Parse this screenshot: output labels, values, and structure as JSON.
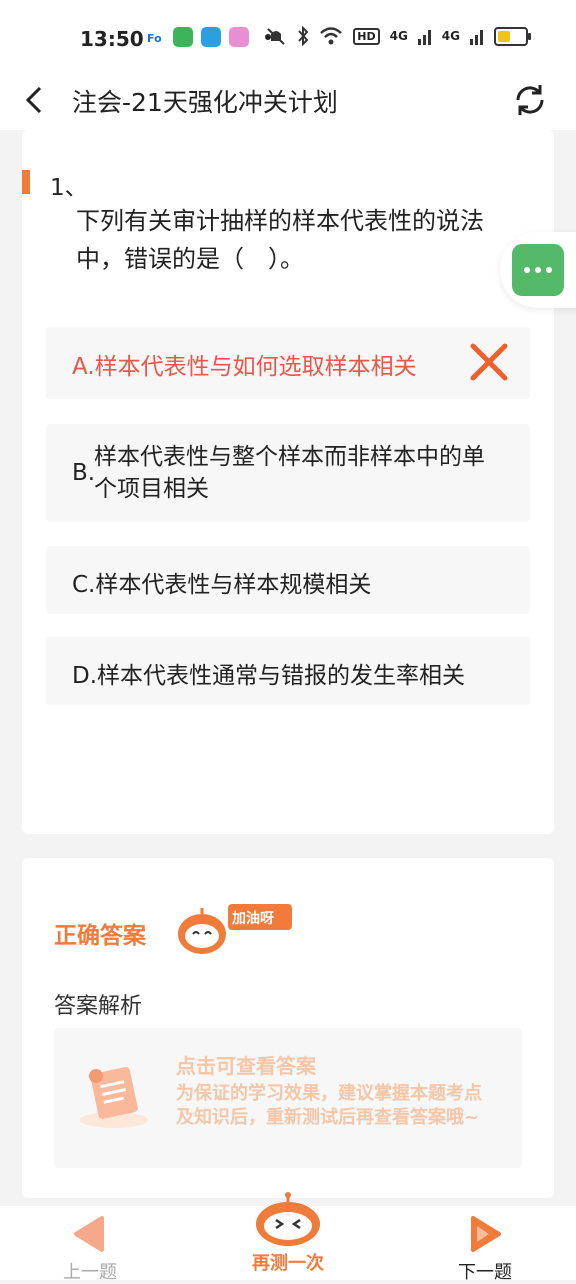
{
  "status_bar": {
    "time": "13:50",
    "net_label": "HD",
    "signal1": "4G",
    "signal2": "4G",
    "battery_level": 0.55
  },
  "header": {
    "title": "注会-21天强化冲关计划"
  },
  "question": {
    "number": "1、",
    "text": "下列有关审计抽样的样本代表性的说法中，错误的是（　）。",
    "options": [
      {
        "text": "A.样本代表性与如何选取样本相关",
        "state": "wrong"
      },
      {
        "letter": "B.",
        "text": "样本代表性与整个样本而非样本中的单个项目相关"
      },
      {
        "text": "C.样本代表性与样本规模相关"
      },
      {
        "text": "D.样本代表性通常与错报的发生率相关"
      }
    ]
  },
  "answer": {
    "correct_label": "正确答案",
    "badge": "加油呀",
    "analysis_label": "答案解析",
    "tip_title": "点击可查看答案",
    "tip_text": "为保证的学习效果，建议掌握本题考点及知识后，重新测试后再查看答案哦~"
  },
  "bottom_nav": {
    "prev": "上一题",
    "retry": "再测一次",
    "next": "下一题"
  },
  "colors": {
    "accent": "#f07b3b",
    "wrong": "#e8574a",
    "float": "#55b96a"
  }
}
